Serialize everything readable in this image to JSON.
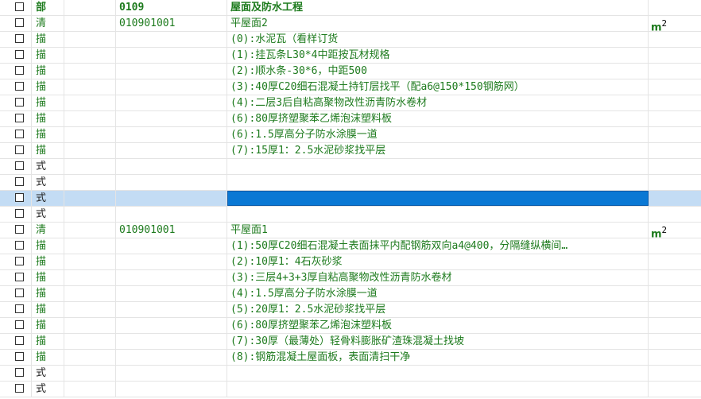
{
  "rows": [
    {
      "type": "部",
      "code": "0109",
      "name": "屋面及防水工程",
      "unit": "",
      "kind": "section"
    },
    {
      "type": "清",
      "code": "010901001",
      "name": "平屋面2",
      "unit": "m",
      "unit_sup": "2",
      "kind": "item"
    },
    {
      "type": "描",
      "code": "",
      "name": "(0):水泥瓦（看样订货",
      "unit": "",
      "kind": "desc"
    },
    {
      "type": "描",
      "code": "",
      "name": "(1):挂瓦条L30*4中距按瓦材规格",
      "unit": "",
      "kind": "desc"
    },
    {
      "type": "描",
      "code": "",
      "name": "(2):顺水条-30*6，中距500",
      "unit": "",
      "kind": "desc"
    },
    {
      "type": "描",
      "code": "",
      "name": "(3):40厚C20细石混凝土持钉层找平（配a6@150*150钢筋网）",
      "unit": "",
      "kind": "desc"
    },
    {
      "type": "描",
      "code": "",
      "name": "(4):二层3后自粘高聚物改性沥青防水卷材",
      "unit": "",
      "kind": "desc"
    },
    {
      "type": "描",
      "code": "",
      "name": "(6):80厚挤塑聚苯乙烯泡沫塑料板",
      "unit": "",
      "kind": "desc"
    },
    {
      "type": "描",
      "code": "",
      "name": "(6):1.5厚高分子防水涂膜一道",
      "unit": "",
      "kind": "desc"
    },
    {
      "type": "描",
      "code": "",
      "name": "(7):15厚1：2.5水泥砂浆找平层",
      "unit": "",
      "kind": "desc"
    },
    {
      "type": "式",
      "code": "",
      "name": "",
      "unit": "",
      "kind": "formula"
    },
    {
      "type": "式",
      "code": "",
      "name": "",
      "unit": "",
      "kind": "formula"
    },
    {
      "type": "式",
      "code": "",
      "name": "",
      "unit": "",
      "kind": "formula",
      "selected": true
    },
    {
      "type": "式",
      "code": "",
      "name": "",
      "unit": "",
      "kind": "formula"
    },
    {
      "type": "清",
      "code": "010901001",
      "name": "平屋面1",
      "unit": "m",
      "unit_sup": "2",
      "kind": "item"
    },
    {
      "type": "描",
      "code": "",
      "name": "(1):50厚C20细石混凝土表面抹平内配钢筋双向a4@400，分隔缝纵横间…",
      "unit": "",
      "kind": "desc"
    },
    {
      "type": "描",
      "code": "",
      "name": "(2):10厚1：4石灰砂浆",
      "unit": "",
      "kind": "desc"
    },
    {
      "type": "描",
      "code": "",
      "name": "(3):三层4+3+3厚自粘高聚物改性沥青防水卷材",
      "unit": "",
      "kind": "desc"
    },
    {
      "type": "描",
      "code": "",
      "name": "(4):1.5厚高分子防水涂膜一道",
      "unit": "",
      "kind": "desc"
    },
    {
      "type": "描",
      "code": "",
      "name": "(5):20厚1：2.5水泥砂浆找平层",
      "unit": "",
      "kind": "desc"
    },
    {
      "type": "描",
      "code": "",
      "name": "(6):80厚挤塑聚苯乙烯泡沫塑料板",
      "unit": "",
      "kind": "desc"
    },
    {
      "type": "描",
      "code": "",
      "name": "(7):30厚（最薄处）轻骨料膨胀矿渣珠混凝土找坡",
      "unit": "",
      "kind": "desc"
    },
    {
      "type": "描",
      "code": "",
      "name": "(8):钢筋混凝土屋面板，表面清扫干净",
      "unit": "",
      "kind": "desc"
    },
    {
      "type": "式",
      "code": "",
      "name": "",
      "unit": "",
      "kind": "formula"
    },
    {
      "type": "式",
      "code": "",
      "name": "",
      "unit": "",
      "kind": "formula"
    }
  ],
  "colors": {
    "text_green": "#1e7b1e",
    "selected_row": "#c3dcf4",
    "edit_cell": "#0a78d4"
  }
}
